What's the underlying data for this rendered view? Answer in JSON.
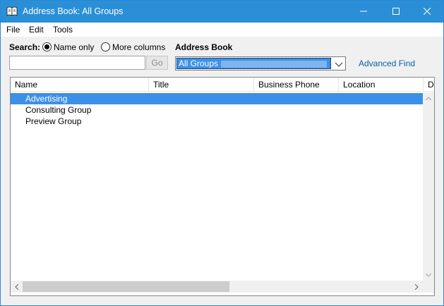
{
  "window": {
    "title": "Address Book: All Groups"
  },
  "menu": [
    {
      "label": "File"
    },
    {
      "label": "Edit"
    },
    {
      "label": "Tools"
    }
  ],
  "search": {
    "label": "Search:",
    "options": [
      {
        "label": "Name only",
        "checked": true
      },
      {
        "label": "More columns",
        "checked": false
      }
    ],
    "input_value": "",
    "go_label": "Go"
  },
  "address_book": {
    "label": "Address Book",
    "selected": "All Groups -",
    "advanced_find": "Advanced Find"
  },
  "columns": [
    {
      "label": "Name"
    },
    {
      "label": "Title"
    },
    {
      "label": "Business Phone"
    },
    {
      "label": "Location"
    },
    {
      "label": "D"
    }
  ],
  "rows": [
    {
      "name": "Advertising",
      "selected": true
    },
    {
      "name": "Consulting Group",
      "selected": false
    },
    {
      "name": "Preview Group",
      "selected": false
    }
  ],
  "colors": {
    "titlebar": "#2b8fd8",
    "selection": "#3c90e8",
    "link": "#0063b1"
  },
  "icons": {
    "app": "address-book-icon",
    "minimize": "minimize-icon",
    "maximize": "maximize-icon",
    "close": "close-icon",
    "dropdown": "chevron-down-icon"
  }
}
